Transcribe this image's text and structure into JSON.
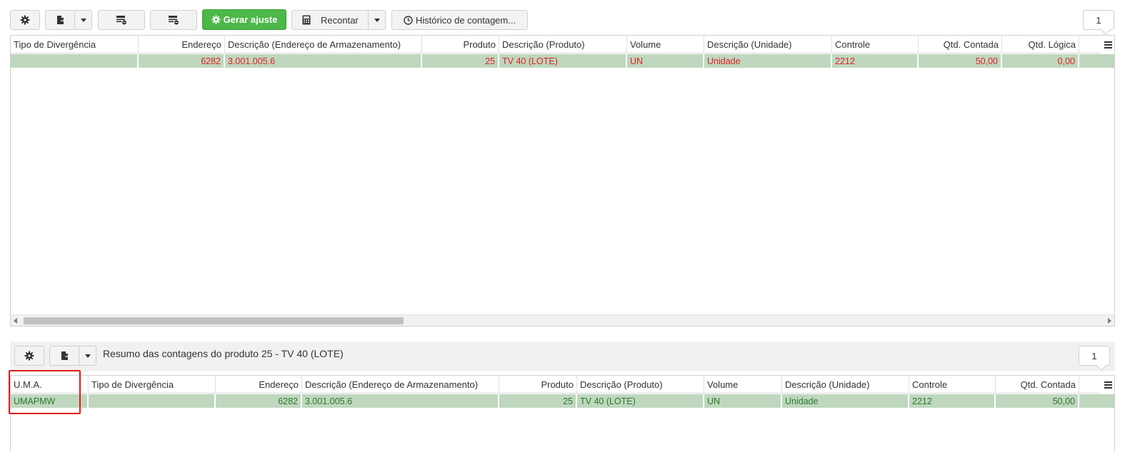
{
  "toolbar": {
    "gerar_ajuste_label": "Gerar ajuste",
    "recontar_label": "Recontar",
    "historico_label": "Histórico de contagem...",
    "page": "1"
  },
  "top_grid": {
    "columns": [
      "Tipo de Divergência",
      "Endereço",
      "Descrição (Endereço de Armazenamento)",
      "Produto",
      "Descrição (Produto)",
      "Volume",
      "Descrição (Unidade)",
      "Controle",
      "Qtd. Contada",
      "Qtd. Lógica"
    ],
    "rows": [
      [
        "",
        "6282",
        "3.001.005.6",
        "25",
        "TV 40 (LOTE)",
        "UN",
        "Unidade",
        "2212",
        "50,00",
        "0,00"
      ]
    ]
  },
  "bottom_panel": {
    "title": "Resumo das contagens do produto  25 - TV 40 (LOTE)",
    "page": "1"
  },
  "bottom_grid": {
    "columns": [
      "U.M.A.",
      "Tipo de Divergência",
      "Endereço",
      "Descrição (Endereço de Armazenamento)",
      "Produto",
      "Descrição (Produto)",
      "Volume",
      "Descrição (Unidade)",
      "Controle",
      "Qtd. Contada"
    ],
    "rows": [
      [
        "UMAPMW",
        "",
        "6282",
        "3.001.005.6",
        "25",
        "TV 40 (LOTE)",
        "UN",
        "Unidade",
        "2212",
        "50,00"
      ]
    ]
  },
  "colors": {
    "accent_green": "#4cb848",
    "row_bg": "#bfd7bf",
    "row_text_red": "#e02020",
    "row_text_green": "#2a7a2a",
    "highlight_border": "#e21b1b"
  }
}
